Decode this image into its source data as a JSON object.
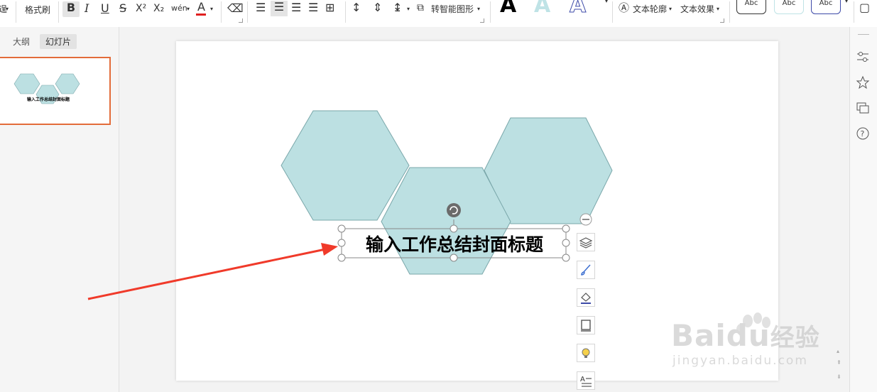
{
  "toolbar": {
    "partial_left": "逞",
    "format_painter": "格式刷",
    "bold": "B",
    "italic": "I",
    "underline": "U",
    "strikethrough": "S",
    "superscript": "X²",
    "subscript": "X₂",
    "phonetic": "wén",
    "font_color": "A",
    "to_smart_shape": "转智能图形",
    "text_outline": "文本轮廓",
    "text_effects": "文本效果",
    "art_letter": "A",
    "style_preset_label": "Abc",
    "colors": {
      "font_color_underline": "#e02020",
      "text_fill_light": "#bfe3e6",
      "text_fill_blue": "#3d4aa8"
    }
  },
  "left_panel": {
    "tabs": [
      {
        "label": "大纲",
        "active": false
      },
      {
        "label": "幻灯片",
        "active": true
      }
    ],
    "thumbnail_title": "输入工作总结封面标题",
    "thumbnail_border": "#e36c3a"
  },
  "slide": {
    "title": "输入工作总结封面标题",
    "hexagon_fill": "#bce0e2",
    "hexagon_stroke": "#7aa7aa",
    "arrow_color": "#f03a2a"
  },
  "float_toolbar": {
    "icons": [
      "layers-icon",
      "brush-icon",
      "fill-icon",
      "outline-icon",
      "lightbulb-icon",
      "text-style-icon"
    ]
  },
  "right_panel": {
    "icons": [
      "adjust-icon",
      "star-icon",
      "slide-switch-icon",
      "help-icon"
    ]
  },
  "watermark": {
    "brand": "Baidu",
    "brand_cn": "经验",
    "url": "jingyan.baidu.com"
  }
}
